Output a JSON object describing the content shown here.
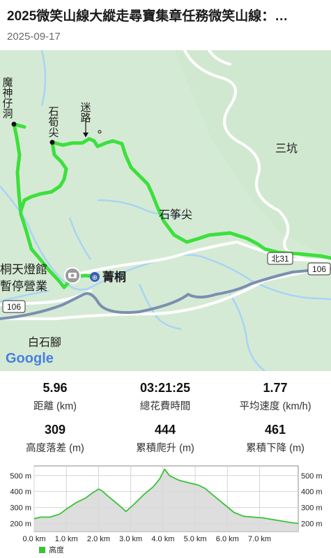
{
  "header": {
    "title": "2025微笑山線大縱走尋寶集章任務微笑山線：…",
    "date": "2025-09-17"
  },
  "map": {
    "labels": {
      "moshen_cave": "魔神仔洞",
      "shixun_jian": "石筍尖",
      "milu": "迷路",
      "sankeng": "三坑",
      "shizheng_jian": "石筝尖",
      "jingtong": "菁桐",
      "tiandeng": "桐天燈館",
      "paused": "暫停營業",
      "baishijiao": "白石腳",
      "road_106_right": "106",
      "road_106_left": "106",
      "road_north31": "北31",
      "rail_symbol": "⊕"
    },
    "google_logo": "Google",
    "colors": {
      "track": "#3ce03c",
      "water": "#a8d4f5",
      "road": "#ffffff",
      "rail": "#7a8fb0",
      "land": "#d9ecd9"
    }
  },
  "stats": [
    {
      "value": "5.96",
      "label": "距離 (km)"
    },
    {
      "value": "03:21:25",
      "label": "總花費時間"
    },
    {
      "value": "1.77",
      "label": "平均速度 (km/h)"
    },
    {
      "value": "309",
      "label": "高度落差 (m)"
    },
    {
      "value": "444",
      "label": "累積爬升 (m)"
    },
    {
      "value": "461",
      "label": "累積下降 (m)"
    }
  ],
  "chart_data": {
    "type": "area",
    "title": "",
    "xlabel": "",
    "ylabel": "",
    "x_ticks": [
      "0.0 km",
      "1.0 km",
      "2.0 km",
      "3.0 km",
      "4.0 km",
      "5.0 km",
      "6.0 km",
      "7.0 km"
    ],
    "y_ticks": [
      "200 m",
      "300 m",
      "400 m",
      "500 m"
    ],
    "xlim": [
      0,
      8.2
    ],
    "ylim": [
      150,
      560
    ],
    "series": [
      {
        "name": "高度",
        "color": "#3ac23a",
        "x": [
          0.0,
          0.2,
          0.5,
          0.8,
          1.0,
          1.3,
          1.6,
          1.8,
          2.0,
          2.1,
          2.3,
          2.6,
          2.85,
          3.1,
          3.4,
          3.7,
          3.9,
          4.05,
          4.2,
          4.5,
          4.8,
          5.1,
          5.3,
          5.6,
          5.9,
          6.2,
          6.5,
          6.8,
          7.1,
          7.4,
          7.7,
          8.0,
          8.2
        ],
        "values": [
          230,
          240,
          240,
          260,
          290,
          330,
          360,
          390,
          415,
          405,
          370,
          320,
          275,
          320,
          380,
          430,
          480,
          540,
          500,
          470,
          455,
          440,
          420,
          370,
          320,
          270,
          245,
          240,
          235,
          225,
          215,
          205,
          200
        ]
      }
    ],
    "grid": true,
    "legend": "bottom-left"
  }
}
